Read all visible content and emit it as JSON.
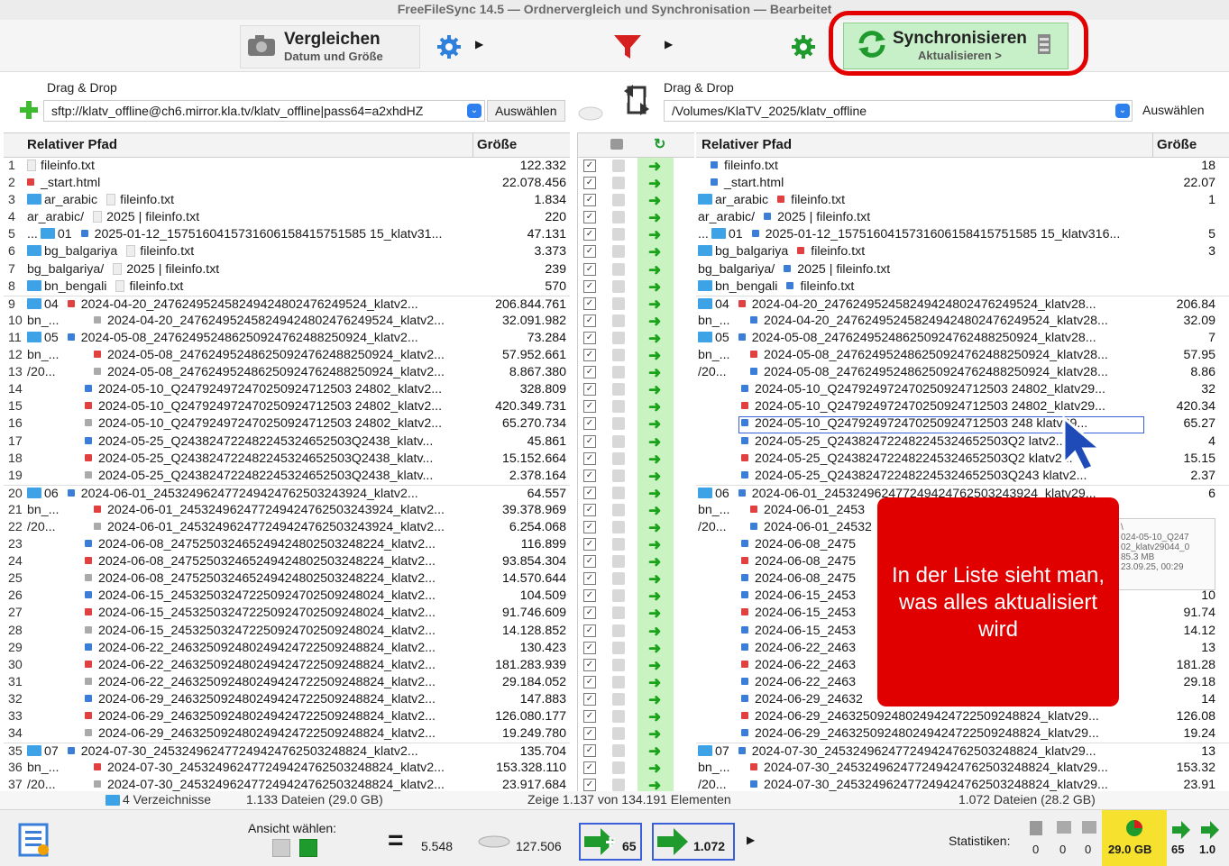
{
  "window": {
    "title": "FreeFileSync 14.5 — Ordnervergleich und Synchronisation — Bearbeitet"
  },
  "toolbar": {
    "compare_label": "Vergleichen",
    "compare_sub": "Datum und Größe",
    "sync_label": "Synchronisieren",
    "sync_sub": "Aktualisieren >"
  },
  "left": {
    "drag": "Drag & Drop",
    "path": "sftp://klatv_offline@ch6.mirror.kla.tv/klatv_offline|pass64=a2xhdHZ",
    "select": "Auswählen",
    "col_path": "Relativer Pfad",
    "col_size": "Größe",
    "status_dirs": "4 Verzeichnisse",
    "status_files": "1.133 Dateien (29.0 GB)"
  },
  "right": {
    "drag": "Drag & Drop",
    "path": "/Volumes/KlaTV_2025/klatv_offline",
    "select": "Auswählen",
    "col_path": "Relativer Pfad",
    "col_size": "Größe",
    "status_files": "1.072 Dateien (28.2 GB)"
  },
  "middle": {
    "status": "Zeige 1.137 von 134.191 Elementen"
  },
  "overlay": {
    "text": "In der Liste sieht man, was alles aktualisiert wird"
  },
  "tooltip": {
    "lines": [
      "\\",
      "024-05-10_Q247",
      "02_klatv29044_0",
      "85.3 MB",
      "23.09.25, 00:29"
    ]
  },
  "bottom": {
    "view_label": "Ansicht wählen:",
    "equal_count": "5.548",
    "disk_count": "127.506",
    "create_count": "65",
    "update_count": "1.072",
    "stats_label": "Statistiken:",
    "stats": [
      "0",
      "0",
      "0",
      "29.0 GB",
      "65",
      "1.0"
    ]
  },
  "rows_left": [
    {
      "n": "1",
      "pre": "",
      "path": "fileinfo.txt",
      "size": "122.332",
      "type": "doc"
    },
    {
      "n": "2",
      "pre": "",
      "path": "_start.html",
      "size": "22.078.456",
      "type": "html"
    },
    {
      "n": "3",
      "pre": "ar_arabic",
      "path": "fileinfo.txt",
      "size": "1.834",
      "type": "dirfile"
    },
    {
      "n": "4",
      "pre": "ar_arabic/",
      "path": "2025 | fileinfo.txt",
      "size": "220",
      "type": "dirfile2"
    },
    {
      "n": "5",
      "pre": "... 01",
      "path": "2025-01-12_1575160415731606158415751585 15_klatv31...",
      "size": "47.131",
      "type": "dirfile"
    },
    {
      "n": "6",
      "pre": "bg_balgariya",
      "path": "fileinfo.txt",
      "size": "3.373",
      "type": "dirfile"
    },
    {
      "n": "7",
      "pre": "bg_balgariya/",
      "path": "2025 | fileinfo.txt",
      "size": "239",
      "type": "dirfile2"
    },
    {
      "n": "8",
      "pre": "bn_bengali",
      "path": "fileinfo.txt",
      "size": "570",
      "type": "dirfile"
    },
    {
      "n": "9",
      "pre": "04",
      "path": "2024-04-20_247624952458249424802476249524_klatv2...",
      "size": "206.844.761",
      "type": "dirfile"
    },
    {
      "n": "10",
      "pre": "bn_...",
      "path": "2024-04-20_247624952458249424802476249524_klatv2...",
      "size": "32.091.982",
      "type": "file"
    },
    {
      "n": "11",
      "pre": "05",
      "path": "2024-05-08_247624952486250924762488250924_klatv2...",
      "size": "73.284",
      "type": "dirfile"
    },
    {
      "n": "12",
      "pre": "bn_...",
      "path": "2024-05-08_247624952486250924762488250924_klatv2...",
      "size": "57.952.661",
      "type": "file"
    },
    {
      "n": "13",
      "pre": "/20...",
      "path": "2024-05-08_247624952486250924762488250924_klatv2...",
      "size": "8.867.380",
      "type": "file"
    },
    {
      "n": "14",
      "pre": "",
      "path": "2024-05-10_Q247924972470250924712503 24802_klatv2...",
      "size": "328.809",
      "type": "file"
    },
    {
      "n": "15",
      "pre": "",
      "path": "2024-05-10_Q247924972470250924712503 24802_klatv2...",
      "size": "420.349.731",
      "type": "file"
    },
    {
      "n": "16",
      "pre": "",
      "path": "2024-05-10_Q247924972470250924712503 24802_klatv2...",
      "size": "65.270.734",
      "type": "file"
    },
    {
      "n": "17",
      "pre": "",
      "path": "2024-05-25_Q243824722482245324652503Q2438_klatv...",
      "size": "45.861",
      "type": "file"
    },
    {
      "n": "18",
      "pre": "",
      "path": "2024-05-25_Q243824722482245324652503Q2438_klatv...",
      "size": "15.152.664",
      "type": "file"
    },
    {
      "n": "19",
      "pre": "",
      "path": "2024-05-25_Q243824722482245324652503Q2438_klatv...",
      "size": "2.378.164",
      "type": "file"
    },
    {
      "n": "20",
      "pre": "06",
      "path": "2024-06-01_245324962477249424762503243924_klatv2...",
      "size": "64.557",
      "type": "dirfile"
    },
    {
      "n": "21",
      "pre": "bn_...",
      "path": "2024-06-01_245324962477249424762503243924_klatv2...",
      "size": "39.378.969",
      "type": "file"
    },
    {
      "n": "22",
      "pre": "/20...",
      "path": "2024-06-01_245324962477249424762503243924_klatv2...",
      "size": "6.254.068",
      "type": "file"
    },
    {
      "n": "23",
      "pre": "",
      "path": "2024-06-08_247525032465249424802503248224_klatv2...",
      "size": "116.899",
      "type": "file"
    },
    {
      "n": "24",
      "pre": "",
      "path": "2024-06-08_247525032465249424802503248224_klatv2...",
      "size": "93.854.304",
      "type": "file"
    },
    {
      "n": "25",
      "pre": "",
      "path": "2024-06-08_247525032465249424802503248224_klatv2...",
      "size": "14.570.644",
      "type": "file"
    },
    {
      "n": "26",
      "pre": "",
      "path": "2024-06-15_245325032472250924702509248024_klatv2...",
      "size": "104.509",
      "type": "file"
    },
    {
      "n": "27",
      "pre": "",
      "path": "2024-06-15_245325032472250924702509248024_klatv2...",
      "size": "91.746.609",
      "type": "file"
    },
    {
      "n": "28",
      "pre": "",
      "path": "2024-06-15_245325032472250924702509248024_klatv2...",
      "size": "14.128.852",
      "type": "file"
    },
    {
      "n": "29",
      "pre": "",
      "path": "2024-06-22_246325092480249424722509248824_klatv2...",
      "size": "130.423",
      "type": "file"
    },
    {
      "n": "30",
      "pre": "",
      "path": "2024-06-22_246325092480249424722509248824_klatv2...",
      "size": "181.283.939",
      "type": "file"
    },
    {
      "n": "31",
      "pre": "",
      "path": "2024-06-22_246325092480249424722509248824_klatv2...",
      "size": "29.184.052",
      "type": "file"
    },
    {
      "n": "32",
      "pre": "",
      "path": "2024-06-29_246325092480249424722509248824_klatv2...",
      "size": "147.883",
      "type": "file"
    },
    {
      "n": "33",
      "pre": "",
      "path": "2024-06-29_246325092480249424722509248824_klatv2...",
      "size": "126.080.177",
      "type": "file"
    },
    {
      "n": "34",
      "pre": "",
      "path": "2024-06-29_246325092480249424722509248824_klatv2...",
      "size": "19.249.780",
      "type": "file"
    },
    {
      "n": "35",
      "pre": "07",
      "path": "2024-07-30_245324962477249424762503248824_klatv2...",
      "size": "135.704",
      "type": "dirfile"
    },
    {
      "n": "36",
      "pre": "bn_...",
      "path": "2024-07-30_245324962477249424762503248824_klatv2...",
      "size": "153.328.110",
      "type": "file"
    },
    {
      "n": "37",
      "pre": "/20...",
      "path": "2024-07-30_245324962477249424762503248824_klatv2...",
      "size": "23.917.684",
      "type": "file"
    }
  ],
  "rows_right": [
    {
      "pre": "",
      "path": "fileinfo.txt",
      "size": "18"
    },
    {
      "pre": "",
      "path": "_start.html",
      "size": "22.07"
    },
    {
      "pre": "ar_arabic",
      "path": "fileinfo.txt",
      "size": "1"
    },
    {
      "pre": "ar_arabic/",
      "path": "2025 | fileinfo.txt",
      "size": ""
    },
    {
      "pre": "... 01",
      "path": "2025-01-12_1575160415731606158415751585 15_klatv316...",
      "size": "5"
    },
    {
      "pre": "bg_balgariya",
      "path": "fileinfo.txt",
      "size": "3"
    },
    {
      "pre": "bg_balgariya/",
      "path": "2025 | fileinfo.txt",
      "size": ""
    },
    {
      "pre": "bn_bengali",
      "path": "fileinfo.txt",
      "size": ""
    },
    {
      "pre": "04",
      "path": "2024-04-20_247624952458249424802476249524_klatv28...",
      "size": "206.84"
    },
    {
      "pre": "bn_...",
      "path": "2024-04-20_247624952458249424802476249524_klatv28...",
      "size": "32.09"
    },
    {
      "pre": "05",
      "path": "2024-05-08_247624952486250924762488250924_klatv28...",
      "size": "7"
    },
    {
      "pre": "bn_...",
      "path": "2024-05-08_247624952486250924762488250924_klatv28...",
      "size": "57.95"
    },
    {
      "pre": "/20...",
      "path": "2024-05-08_247624952486250924762488250924_klatv28...",
      "size": "8.86"
    },
    {
      "pre": "",
      "path": "2024-05-10_Q247924972470250924712503 24802_klatv29...",
      "size": "32"
    },
    {
      "pre": "",
      "path": "2024-05-10_Q247924972470250924712503 24802_klatv29...",
      "size": "420.34"
    },
    {
      "pre": "",
      "path": "2024-05-10_Q247924972470250924712503 248 klatv29...",
      "size": "65.27"
    },
    {
      "pre": "",
      "path": "2024-05-25_Q243824722482245324652503Q2 latv2...",
      "size": "4"
    },
    {
      "pre": "",
      "path": "2024-05-25_Q243824722482245324652503Q2 klatv2...",
      "size": "15.15"
    },
    {
      "pre": "",
      "path": "2024-05-25_Q243824722482245324652503Q243 klatv2...",
      "size": "2.37"
    },
    {
      "pre": "06",
      "path": "2024-06-01_245324962477249424762503243924_klatv29...",
      "size": "6"
    },
    {
      "pre": "bn_...",
      "path": "2024-06-01_2453",
      "size": ""
    },
    {
      "pre": "/20...",
      "path": "2024-06-01_24532",
      "size": ""
    },
    {
      "pre": "",
      "path": "2024-06-08_2475",
      "size": ""
    },
    {
      "pre": "",
      "path": "2024-06-08_2475",
      "size": ""
    },
    {
      "pre": "",
      "path": "2024-06-08_2475",
      "size": ""
    },
    {
      "pre": "",
      "path": "2024-06-15_2453",
      "size": "10"
    },
    {
      "pre": "",
      "path": "2024-06-15_2453",
      "size": "91.74"
    },
    {
      "pre": "",
      "path": "2024-06-15_2453",
      "size": "14.12"
    },
    {
      "pre": "",
      "path": "2024-06-22_2463",
      "size": "13"
    },
    {
      "pre": "",
      "path": "2024-06-22_2463",
      "size": "181.28"
    },
    {
      "pre": "",
      "path": "2024-06-22_2463",
      "size": "29.18"
    },
    {
      "pre": "",
      "path": "2024-06-29_24632",
      "size": "14"
    },
    {
      "pre": "",
      "path": "2024-06-29_246325092480249424722509248824_klatv29...",
      "size": "126.08"
    },
    {
      "pre": "",
      "path": "2024-06-29_246325092480249424722509248824_klatv29...",
      "size": "19.24"
    },
    {
      "pre": "07",
      "path": "2024-07-30_245324962477249424762503248824_klatv29...",
      "size": "13"
    },
    {
      "pre": "bn_...",
      "path": "2024-07-30_245324962477249424762503248824_klatv29...",
      "size": "153.32"
    },
    {
      "pre": "/20...",
      "path": "2024-07-30_245324962477249424762503248824_klatv29...",
      "size": "23.91"
    }
  ]
}
